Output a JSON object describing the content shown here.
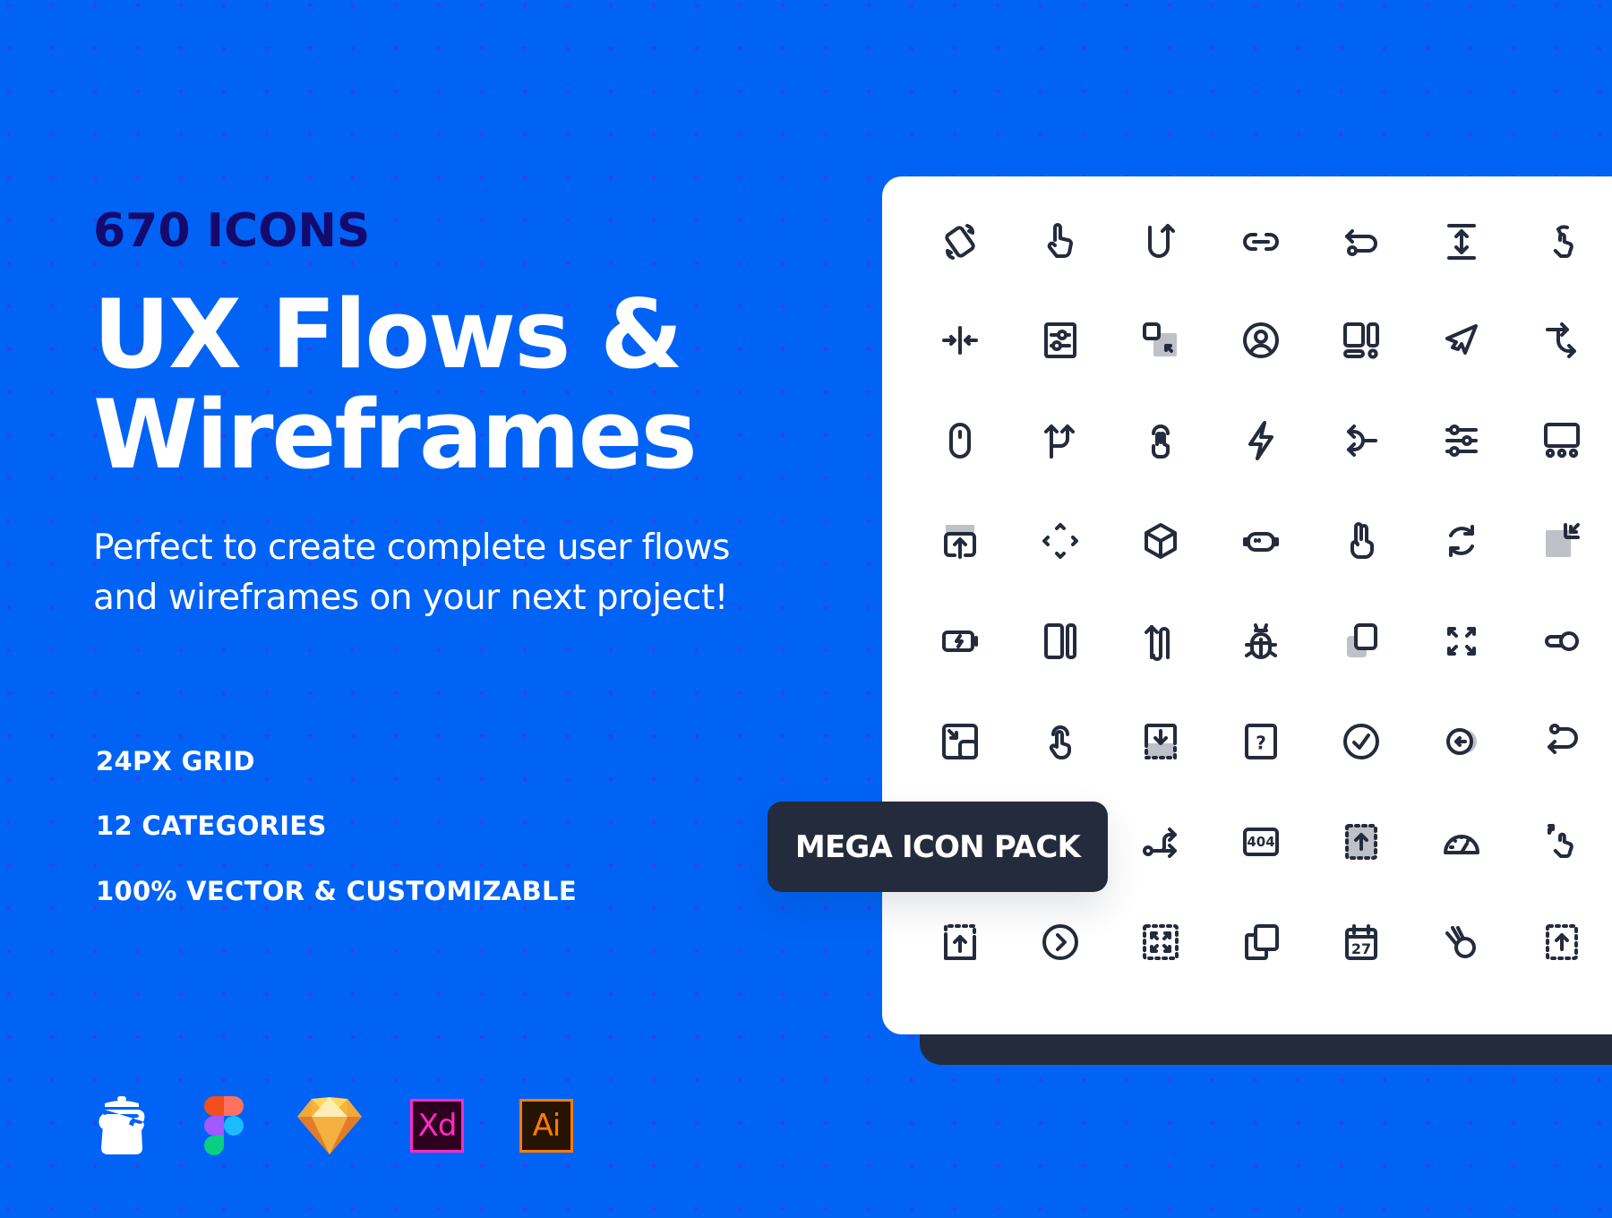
{
  "hero": {
    "eyebrow": "670 ICONS",
    "title_line1": "UX Flows &",
    "title_line2": "Wireframes",
    "subtitle": "Perfect to create complete user flows and wireframes on your next project!"
  },
  "features": [
    "24PX GRID",
    "12 CATEGORIES",
    "100% VECTOR & CUSTOMIZABLE"
  ],
  "apps": [
    {
      "name": "Iconjar",
      "icon": "iconjar-icon"
    },
    {
      "name": "Figma",
      "icon": "figma-icon"
    },
    {
      "name": "Sketch",
      "icon": "sketch-icon"
    },
    {
      "name": "Adobe XD",
      "icon": "adobe-xd-icon",
      "label": "Xd",
      "color": "#FF2BC2",
      "bg": "#2E001F"
    },
    {
      "name": "Adobe Illustrator",
      "icon": "adobe-illustrator-icon",
      "label": "Ai",
      "color": "#FF7C00",
      "bg": "#261300"
    }
  ],
  "badge": {
    "label": "MEGA ICON PACK"
  },
  "colors": {
    "background": "#0063F5",
    "dots": "#2F45E6",
    "eyebrow": "#140A6E",
    "dark": "#242B3C",
    "panel": "#FFFFFF",
    "icon_stroke": "#242B3C",
    "icon_fill_muted": "#BEC1C7"
  },
  "icon_grid": {
    "rows": [
      [
        "rotate-device-icon",
        "tap-finger-icon",
        "u-turn-up-icon",
        "link-icon",
        "flow-return-icon",
        "vertical-resize-icon",
        "swipe-back-gesture-icon"
      ],
      [
        "collapse-horizontal-icon",
        "settings-panel-icon",
        "drag-to-corner-icon",
        "user-circle-icon",
        "dashboard-layout-icon",
        "cursor-pointer-icon",
        "branch-right-icon"
      ],
      [
        "mouse-icon",
        "split-arrows-icon",
        "double-tap-icon",
        "lightning-icon",
        "merge-left-icon",
        "sliders-icon",
        "carousel-icon"
      ],
      [
        "upload-screen-icon",
        "expand-diamond-icon",
        "cube-icon",
        "robot-icon",
        "two-fingers-icon",
        "refresh-icon",
        "minimize-corner-icon"
      ],
      [
        "battery-charging-icon",
        "columns-icon",
        "up-down-path-icon",
        "bug-icon",
        "layer-stack-icon",
        "fullscreen-arrows-icon",
        "toggle-key-icon"
      ],
      [
        "minimize-window-icon",
        "tap-hold-icon",
        "download-area-icon",
        "help-box-icon",
        "check-circle-icon",
        "back-coin-icon",
        "loop-back-icon"
      ],
      [
        "hidden-icon",
        "hidden-icon",
        "flow-split-icon",
        "error-404-icon",
        "upload-dashed-filled-icon",
        "speedometer-icon",
        "pinch-gesture-icon"
      ],
      [
        "upload-box-icon",
        "chevron-circle-icon",
        "fullscreen-dashed-icon",
        "copy-icon",
        "calendar-icon",
        "swipe-ball-icon",
        "upload-dashed-icon"
      ]
    ],
    "text_labels": {
      "error-404-icon": "404",
      "calendar-icon": "27",
      "help-box-icon": "?"
    }
  }
}
